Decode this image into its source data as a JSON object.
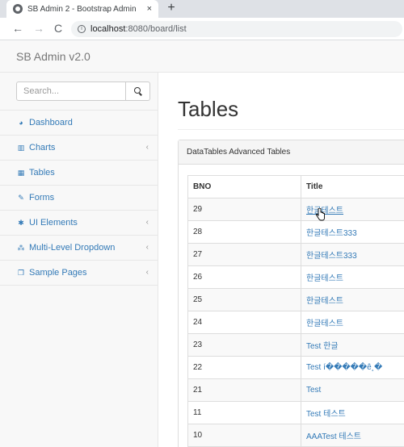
{
  "browser": {
    "tab_title": "SB Admin 2 - Bootstrap Admin",
    "tab_close": "×",
    "new_tab": "+",
    "back": "←",
    "forward": "→",
    "reload": "C",
    "info": "i",
    "url_host": "localhost",
    "url_path": ":8080/board/list"
  },
  "app": {
    "brand": "SB Admin v2.0"
  },
  "sidebar": {
    "search_placeholder": "Search...",
    "items": [
      {
        "icon": "dashboard-icon",
        "glyph": "◕",
        "label": "Dashboard",
        "chevron": ""
      },
      {
        "icon": "bar-chart-icon",
        "glyph": "▥",
        "label": "Charts",
        "chevron": "‹"
      },
      {
        "icon": "table-icon",
        "glyph": "▦",
        "label": "Tables",
        "chevron": ""
      },
      {
        "icon": "edit-icon",
        "glyph": "✎",
        "label": "Forms",
        "chevron": ""
      },
      {
        "icon": "wrench-icon",
        "glyph": "✱",
        "label": "UI Elements",
        "chevron": "‹"
      },
      {
        "icon": "sitemap-icon",
        "glyph": "⁂",
        "label": "Multi-Level Dropdown",
        "chevron": "‹"
      },
      {
        "icon": "files-icon",
        "glyph": "❐",
        "label": "Sample Pages",
        "chevron": "‹"
      }
    ]
  },
  "main": {
    "page_title": "Tables",
    "panel_heading": "DataTables Advanced Tables",
    "columns": [
      "BNO",
      "Title"
    ],
    "rows": [
      {
        "bno": "29",
        "title": "한글테스트"
      },
      {
        "bno": "28",
        "title": "한글테스트333"
      },
      {
        "bno": "27",
        "title": "한글테스트333"
      },
      {
        "bno": "26",
        "title": "한글테스트"
      },
      {
        "bno": "25",
        "title": "한글테스트"
      },
      {
        "bno": "24",
        "title": "한글테스트"
      },
      {
        "bno": "23",
        "title": "Test 한글"
      },
      {
        "bno": "22",
        "title": "Test í�����ê¸�"
      },
      {
        "bno": "21",
        "title": "Test"
      },
      {
        "bno": "11",
        "title": "Test 테스트"
      },
      {
        "bno": "10",
        "title": "AAATest 테스트"
      }
    ]
  },
  "colors": {
    "link": "#337ab7",
    "sidebar_bg": "#f8f8f8",
    "border": "#e7e7e7"
  }
}
